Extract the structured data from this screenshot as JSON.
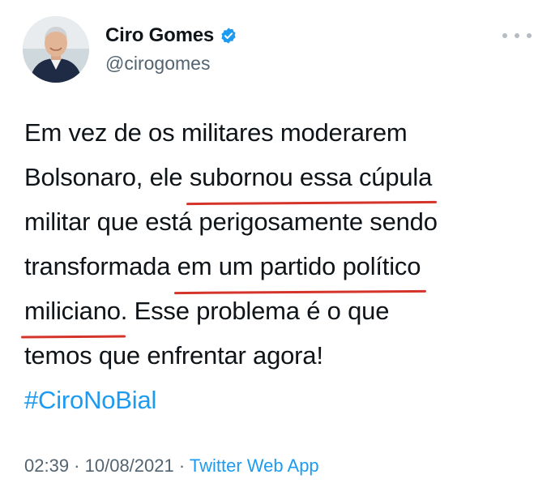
{
  "author": {
    "display_name": "Ciro Gomes",
    "handle": "@cirogomes",
    "verified_icon": "verified-badge-icon",
    "more_icon": "more-options-icon"
  },
  "tweet": {
    "lines": [
      {
        "pre": "Em vez de os militares moderarem",
        "hl": "",
        "post": ""
      },
      {
        "pre": "Bolsonaro, ele ",
        "hl": "subornou essa cúpula",
        "post": ""
      },
      {
        "pre": "militar que está perigosamente sendo",
        "hl": "",
        "post": ""
      },
      {
        "pre": "transformada ",
        "hl": "em um partido político",
        "post": ""
      },
      {
        "pre": "",
        "hl": "miliciano",
        "post": ". Esse problema é o que"
      },
      {
        "pre": "temos que enfrentar agora!",
        "hl": "",
        "post": ""
      }
    ],
    "hashtag": "#CiroNoBial"
  },
  "meta": {
    "time": "02:39",
    "sep1": " · ",
    "date": "10/08/2021",
    "sep2": " · ",
    "app": "Twitter Web App"
  },
  "colors": {
    "link": "#1d9bf0",
    "underline": "#d5342b",
    "secondary": "#536471"
  }
}
